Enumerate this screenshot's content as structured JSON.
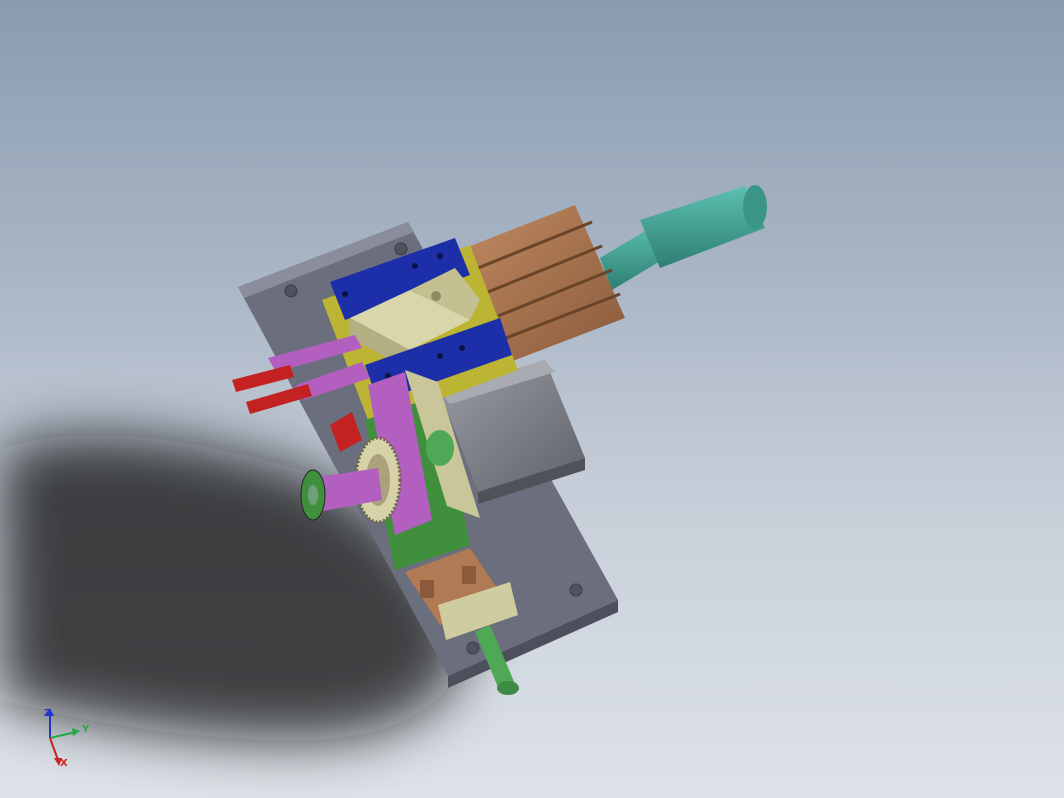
{
  "viewport": {
    "background_top": "#8a9bb0",
    "background_bottom": "#dde2e8"
  },
  "axis_triad": {
    "z_label": "Z",
    "y_label": "Y",
    "x_label": "X",
    "z_color": "#2233cc",
    "y_color": "#22aa44",
    "x_color": "#cc2222"
  },
  "model": {
    "colors": {
      "base_plate": "#6e7180",
      "cylinder_body": "#a4714e",
      "piston_rod": "#3f9e8f",
      "clamp_blue": "#1c2fa8",
      "block_tan": "#cfcca0",
      "yellow_plate": "#c9c238",
      "motor_gray": "#7c7f86",
      "finger_red": "#c42222",
      "arm_purple": "#b25fc0",
      "green_part": "#3f8f3c",
      "shaft_green": "#4fa855",
      "bracket_brown": "#b07a55"
    }
  }
}
